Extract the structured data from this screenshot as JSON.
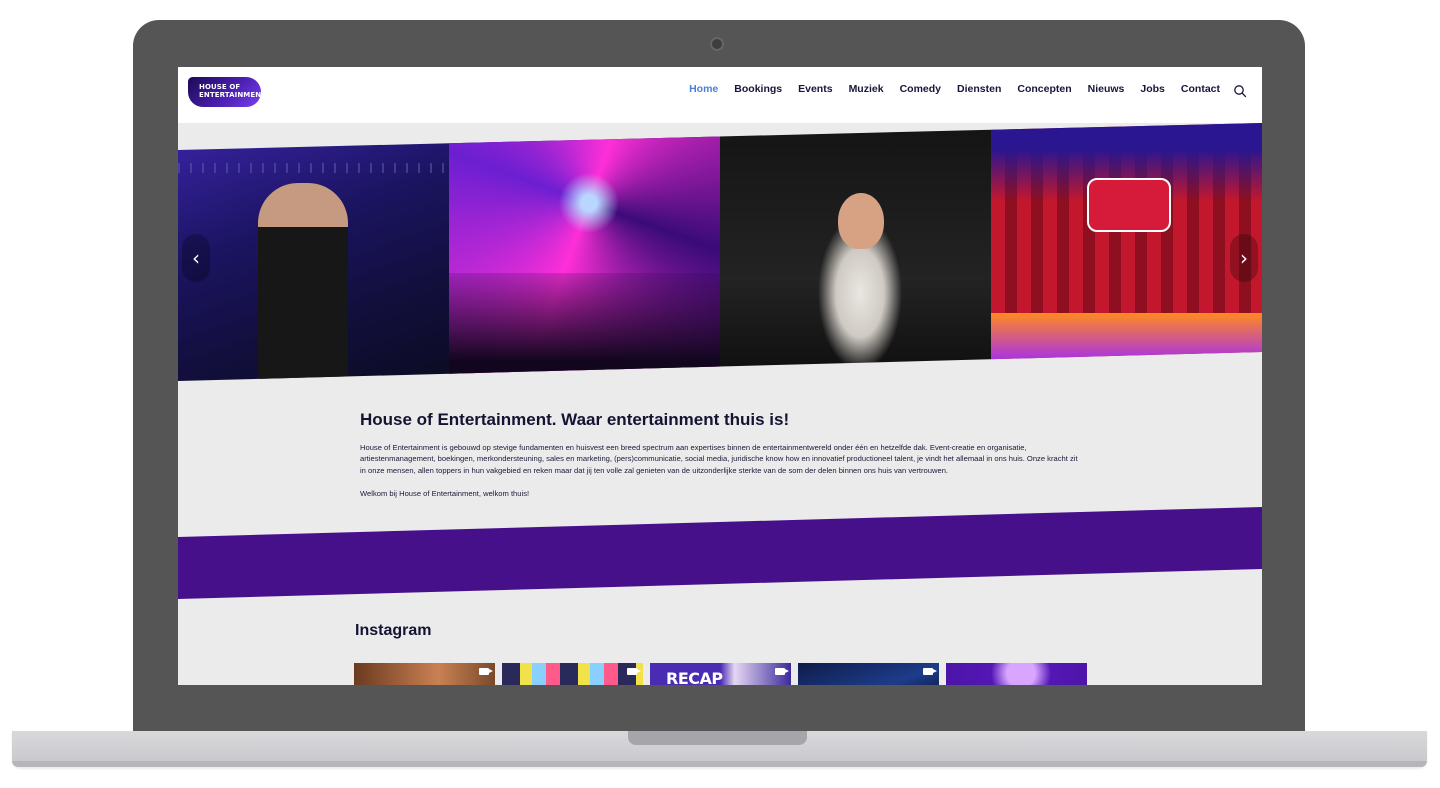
{
  "header": {
    "logo_line1": "HOUSE OF",
    "logo_line2": "ENTERTAINMENT",
    "nav": [
      "Home",
      "Bookings",
      "Events",
      "Muziek",
      "Comedy",
      "Diensten",
      "Concepten",
      "Nieuws",
      "Jobs",
      "Contact"
    ],
    "active_nav": "Home",
    "search_icon": "search-icon"
  },
  "hero": {
    "prev_arrow": "‹",
    "next_arrow": "›"
  },
  "intro": {
    "title": "House of Entertainment. Waar entertainment thuis is!",
    "paragraph": "House of Entertainment is gebouwd op stevige fundamenten en huisvest een breed spectrum aan expertises binnen de entertainmentwereld onder één en hetzelfde dak. Event-creatie en organisatie, artiestenmanagement, boekingen, merkondersteuning, sales en marketing, (pers)communicatie, social media, juridische know how en innovatief productioneel talent, je vindt het allemaal in ons huis. Onze kracht zit in onze mensen, allen toppers in hun vakgebied en reken maar dat jij ten volle zal genieten van de uitzonderlijke sterkte van de som der delen binnen ons huis van vertrouwen.",
    "welcome": "Welkom bij House of Entertainment, welkom thuis!"
  },
  "instagram": {
    "title": "Instagram",
    "tile3_text": "RECAP"
  },
  "colors": {
    "nav_active": "#4a7fd8",
    "band": "#46108a",
    "text_dark": "#141432"
  }
}
